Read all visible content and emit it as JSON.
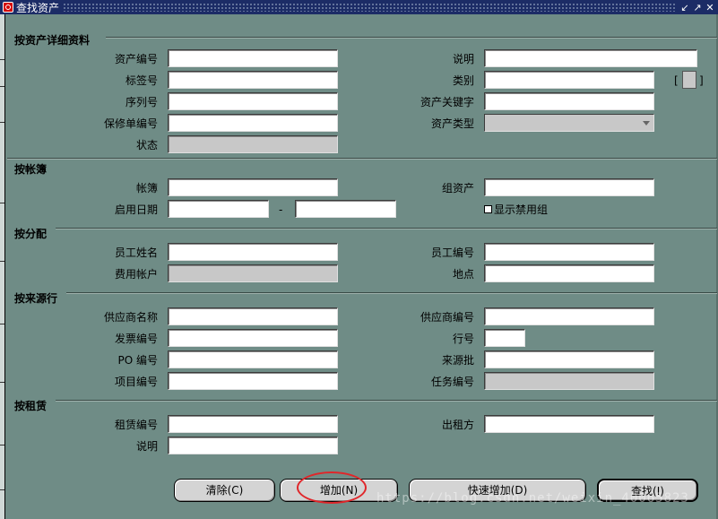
{
  "window": {
    "title": "查找资产",
    "controls": [
      "↙",
      "↗",
      "✕"
    ]
  },
  "sections": {
    "asset_details": {
      "title": "按资产详细资料",
      "asset_number": "资产编号",
      "description": "说明",
      "tag_number": "标签号",
      "category": "类别",
      "serial_number": "序列号",
      "asset_key": "资产关键字",
      "warranty_number": "保修单编号",
      "asset_type": "资产类型",
      "status": "状态",
      "bracket_open": "[",
      "bracket_close": "]"
    },
    "book": {
      "title": "按帐簿",
      "book": "帐簿",
      "group_asset": "组资产",
      "date_in_service": "启用日期",
      "range_dash": "-",
      "show_disabled_groups": "显示禁用组"
    },
    "assignment": {
      "title": "按分配",
      "employee_name": "员工姓名",
      "employee_number": "员工编号",
      "expense_account": "费用帐户",
      "location": "地点"
    },
    "source_lines": {
      "title": "按来源行",
      "supplier_name": "供应商名称",
      "supplier_number": "供应商编号",
      "invoice_number": "发票编号",
      "line_number": "行号",
      "po_number": "PO 编号",
      "source_batch": "来源批",
      "project_number": "项目编号",
      "task_number": "任务编号"
    },
    "lease": {
      "title": "按租赁",
      "lease_number": "租赁编号",
      "lessor": "出租方",
      "description": "说明"
    }
  },
  "buttons": {
    "clear": "清除(C)",
    "add": "增加(N)",
    "quick_add": "快速增加(D)",
    "find": "查找(I)"
  },
  "watermark": "https://blog.csdn.net/weixin_40065823",
  "colors": {
    "background": "#6f8c86",
    "titlebar": "#1c2c66",
    "highlight": "#e0262a"
  }
}
